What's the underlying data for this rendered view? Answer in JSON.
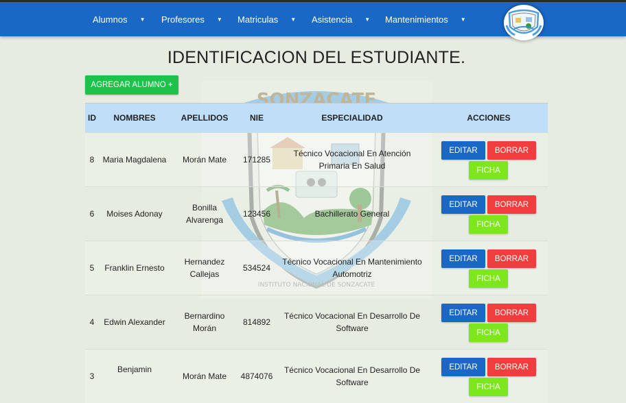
{
  "nav": {
    "items": [
      {
        "label": "Alumnos"
      },
      {
        "label": "Profesores"
      },
      {
        "label": "Matriculas"
      },
      {
        "label": "Asistencia"
      },
      {
        "label": "Mantenimientos"
      }
    ]
  },
  "page": {
    "title": "IDENTIFICACION DEL ESTUDIANTE.",
    "add_button": "AGREGAR ALUMNO +"
  },
  "table": {
    "headers": {
      "id": "ID",
      "nombres": "NOMBRES",
      "apellidos": "APELLIDOS",
      "nie": "NIE",
      "especialidad": "ESPECIALIDAD",
      "acciones": "ACCIONES"
    },
    "actions": {
      "edit": "EDITAR",
      "delete": "BORRAR",
      "ficha": "FICHA"
    },
    "rows": [
      {
        "id": "8",
        "nombres": "Maria Magdalena",
        "apellidos": "Morán Mate",
        "nie": "171285",
        "especialidad": "Técnico Vocacional En Atención Primaria En Salud"
      },
      {
        "id": "6",
        "nombres": "Moises Adonay",
        "apellidos": "Bonilla Alvarenga",
        "nie": "123456",
        "especialidad": "Bachillerato General"
      },
      {
        "id": "5",
        "nombres": "Franklin Ernesto",
        "apellidos": "Hernandez Callejas",
        "nie": "534524",
        "especialidad": "Técnico Vocacional En Mantenimiento Automotriz"
      },
      {
        "id": "4",
        "nombres": "Edwin Alexander",
        "apellidos": "Bernardino Morán",
        "nie": "814892",
        "especialidad": "Técnico Vocacional En Desarrollo De Software"
      },
      {
        "id": "3",
        "nombres": "Benjamin",
        "apellidos": "Morán Mate",
        "nie": "4874076",
        "especialidad": "Técnico Vocacional En Desarrollo De Software"
      }
    ]
  },
  "watermark": {
    "name": "SONZACATE",
    "ring_text": "INSTITUTO NACIONAL DE SONZACATE"
  },
  "colors": {
    "navbar": "#1a68c6",
    "header_row": "#bfdff8",
    "add_button": "#1cc24a",
    "edit_button": "#1a68c6",
    "delete_button": "#f13d3d",
    "ficha_button": "#7ee61d",
    "background": "#e6ece1"
  },
  "icons": [
    "chevron-down-icon",
    "school-logo",
    "school-crest-watermark"
  ]
}
